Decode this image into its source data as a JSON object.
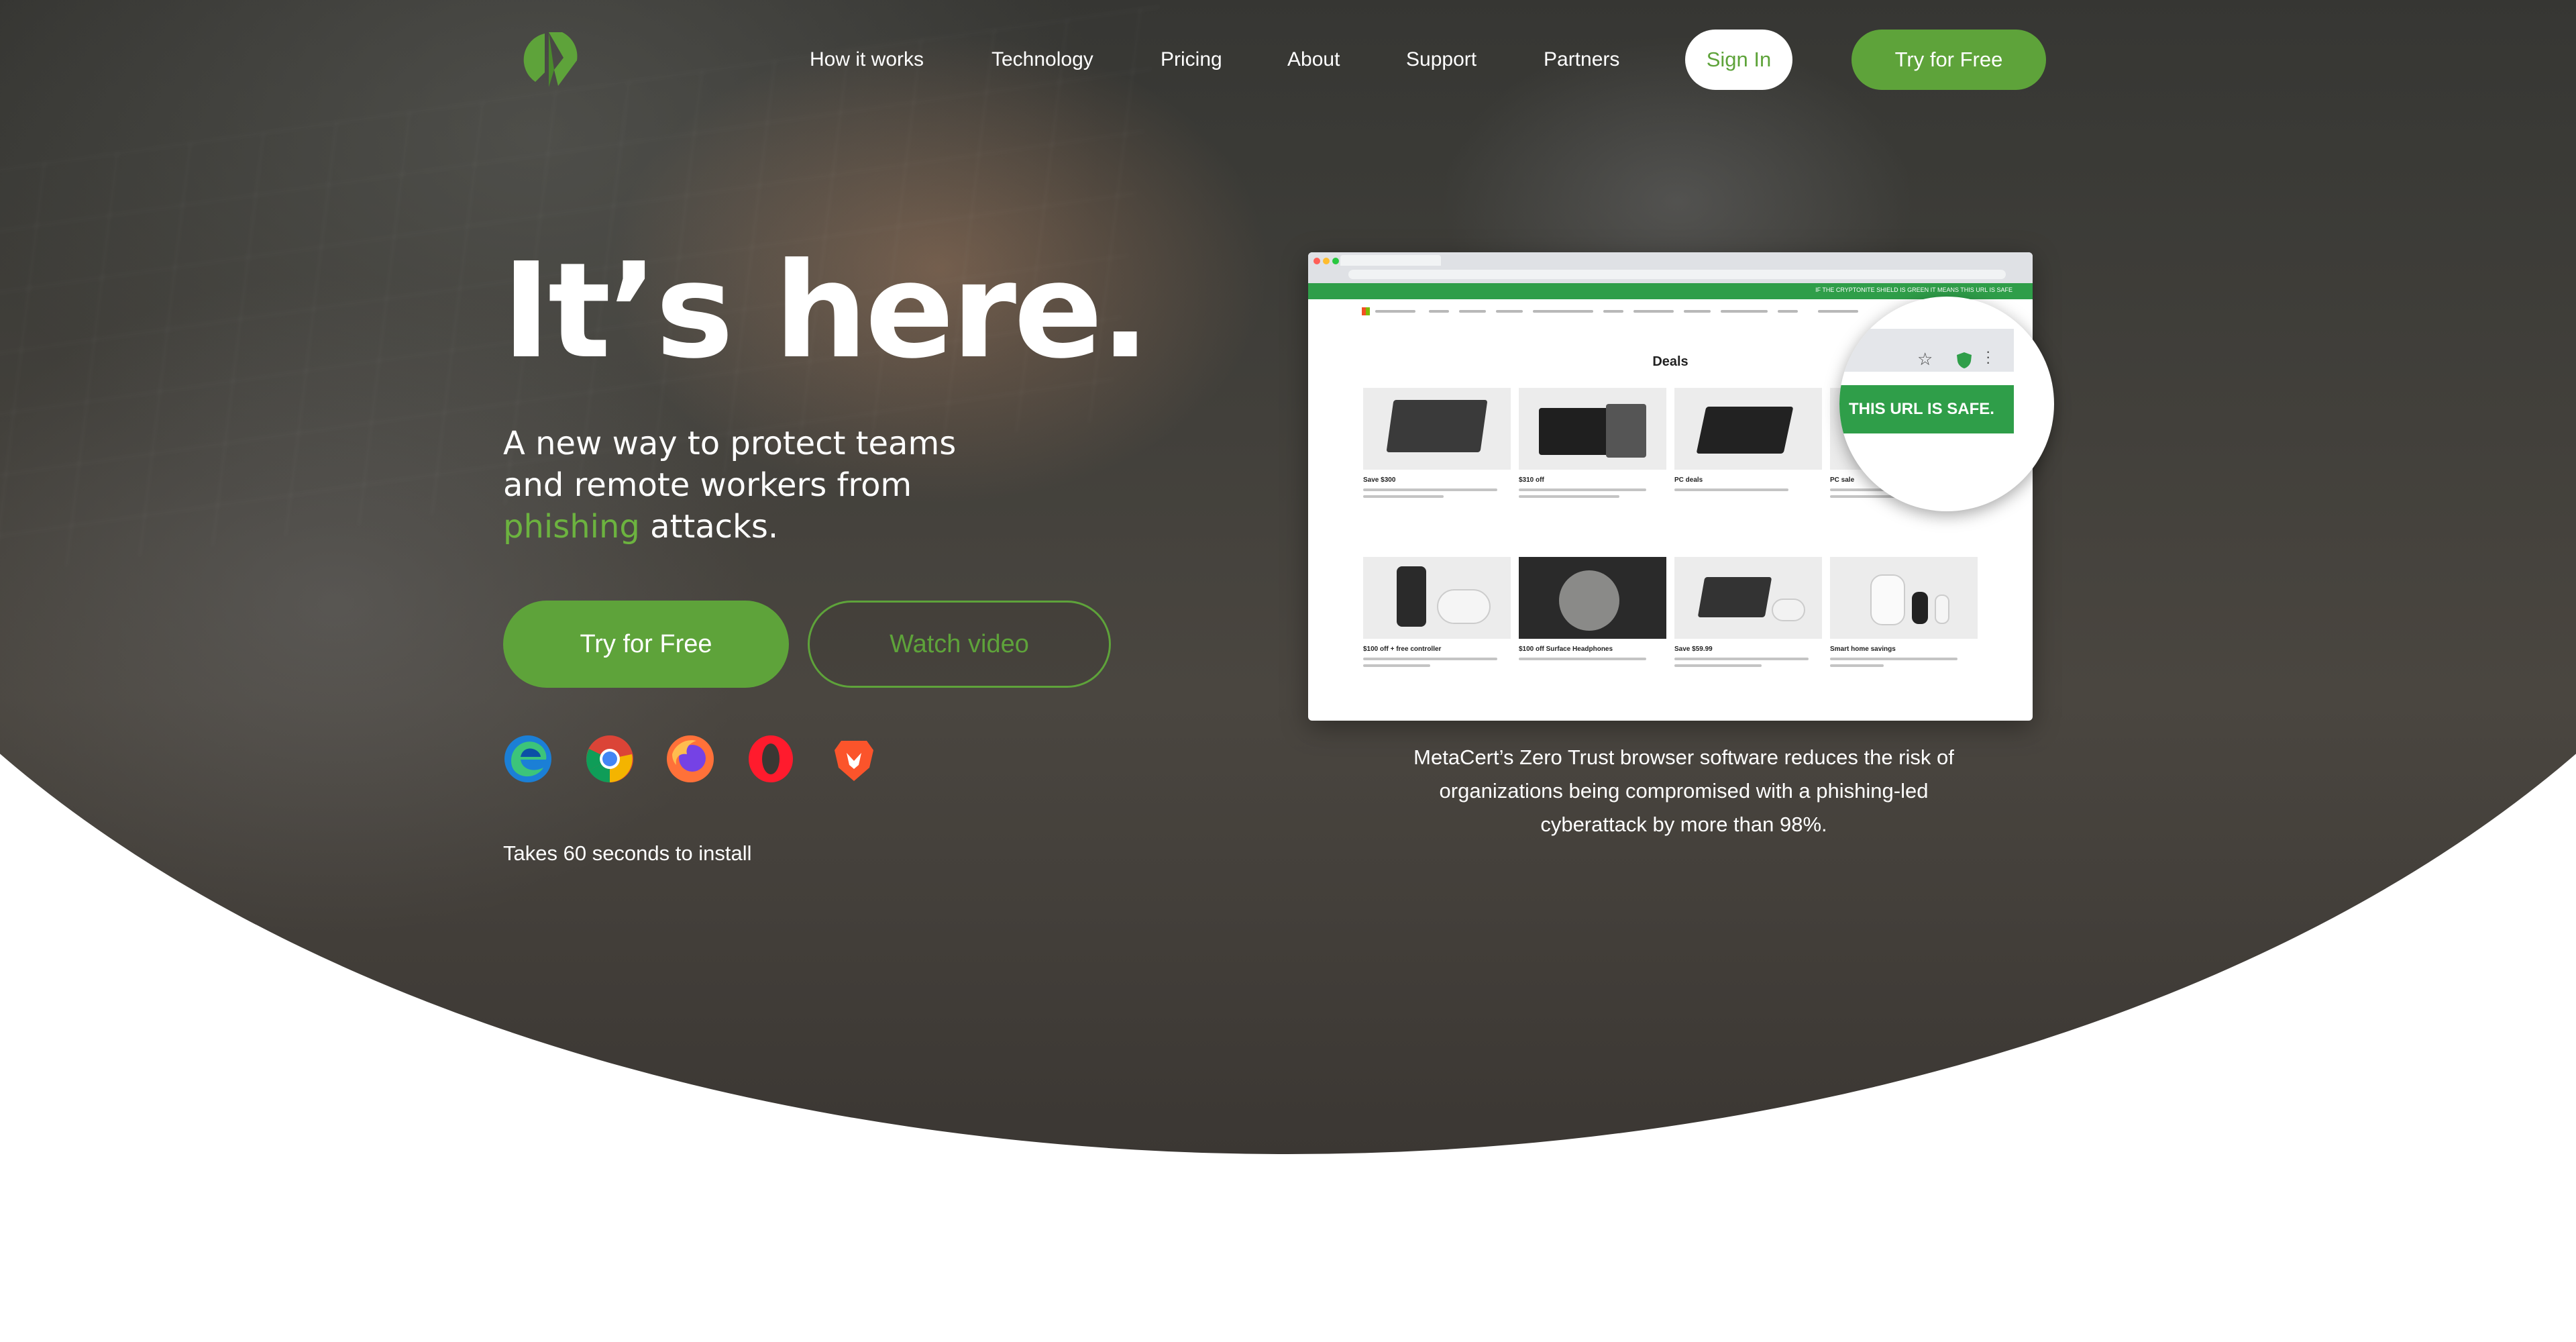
{
  "nav": {
    "links": [
      "How it works",
      "Technology",
      "Pricing",
      "About",
      "Support",
      "Partners"
    ],
    "signin_label": "Sign In",
    "try_label": "Try for Free"
  },
  "hero": {
    "headline": "It’s here.",
    "subhead_line1": "A new way to protect teams",
    "subhead_line2": "and remote workers from",
    "subhead_accent": "phishing",
    "subhead_tail": "attacks.",
    "try_label": "Try for Free",
    "watch_label": "Watch video",
    "browsers": [
      "edge-icon",
      "chrome-icon",
      "firefox-icon",
      "opera-icon",
      "brave-icon"
    ],
    "install_note": "Takes 60 seconds to install"
  },
  "screenshot": {
    "banner_text": "IF THE CRYPTONITE SHIELD IS GREEN IT MEANS THIS URL IS SAFE",
    "deals_title": "Deals",
    "tiles": [
      "Save $300",
      "$310 off",
      "PC deals",
      "PC sale",
      "$100 off + free controller",
      "$100 off Surface Headphones",
      "Save $59.99",
      "Smart home savings"
    ],
    "safe_label": "THIS URL IS SAFE."
  },
  "caption": "MetaCert’s Zero Trust browser software reduces the risk of organizations being compromised with a phishing-led cyberattack by more than 98%.",
  "colors": {
    "accent": "#5ea33a",
    "accent_text": "#6cb33f",
    "safe_green": "#2f9e49",
    "hero_dark": "#2a2a28"
  }
}
